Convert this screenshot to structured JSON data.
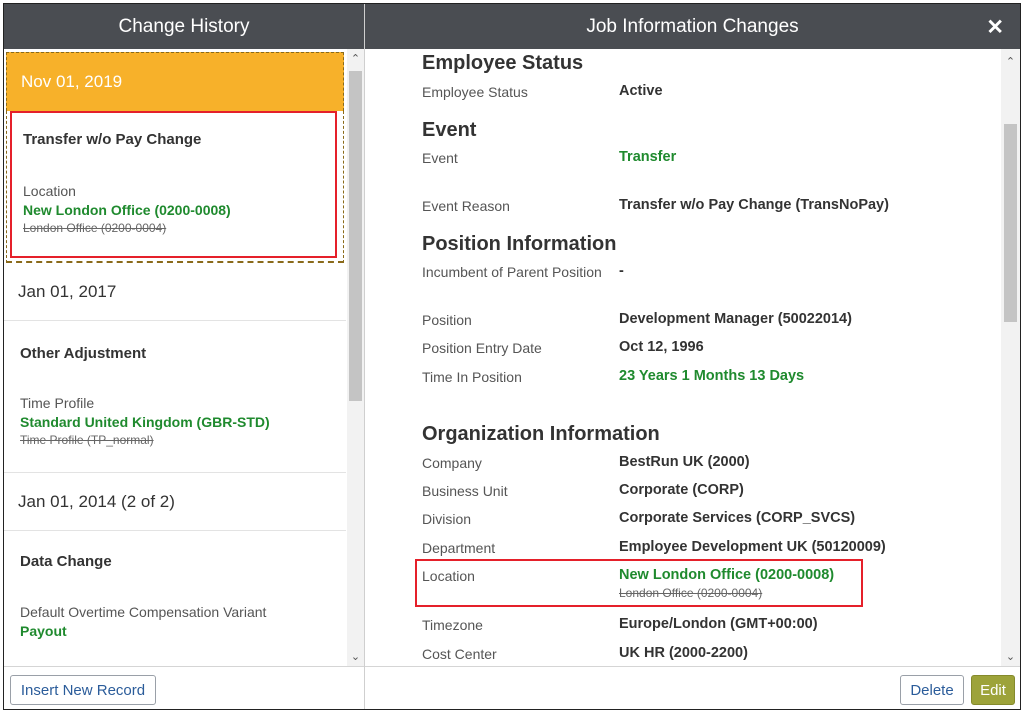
{
  "left_panel": {
    "title": "Change History",
    "records": [
      {
        "date": "Nov 01, 2019",
        "event": "Transfer w/o Pay Change",
        "field_label": "Location",
        "new_value": "New London Office (0200-0008)",
        "old_value": "London Office (0200-0004)"
      },
      {
        "date": "Jan 01, 2017",
        "event": "Other Adjustment",
        "field_label": "Time Profile",
        "new_value": "Standard United Kingdom (GBR-STD)",
        "old_value": "Time Profile (TP_normal)"
      },
      {
        "date": "Jan 01, 2014 (2 of 2)",
        "event": "Data Change",
        "field_label": "Default Overtime Compensation Variant",
        "new_value": "Payout",
        "old_value": ""
      }
    ],
    "insert_button": "Insert New Record"
  },
  "right_panel": {
    "title": "Job Information Changes",
    "close": "✕",
    "sections": {
      "employee_status": {
        "heading": "Employee Status",
        "status_label": "Employee Status",
        "status_value": "Active"
      },
      "event": {
        "heading": "Event",
        "event_label": "Event",
        "event_value": "Transfer",
        "reason_label": "Event Reason",
        "reason_value": "Transfer w/o Pay Change (TransNoPay)"
      },
      "position": {
        "heading": "Position Information",
        "incumbent_label": "Incumbent of Parent Position",
        "incumbent_value": "-",
        "position_label": "Position",
        "position_value": "Development Manager (50022014)",
        "entry_label": "Position Entry Date",
        "entry_value": "Oct 12, 1996",
        "time_label": "Time In Position",
        "time_value": "23 Years 1 Months 13 Days"
      },
      "organization": {
        "heading": "Organization Information",
        "company_label": "Company",
        "company_value": "BestRun UK (2000)",
        "bu_label": "Business Unit",
        "bu_value": "Corporate (CORP)",
        "division_label": "Division",
        "division_value": "Corporate Services (CORP_SVCS)",
        "dept_label": "Department",
        "dept_value": "Employee Development UK (50120009)",
        "location_label": "Location",
        "location_new": "New London Office (0200-0008)",
        "location_old": "London Office (0200-0004)",
        "tz_label": "Timezone",
        "tz_value": "Europe/London (GMT+00:00)",
        "cc_label": "Cost Center",
        "cc_value": "UK HR (2000-2200)"
      }
    },
    "delete_button": "Delete",
    "edit_button": "Edit"
  },
  "colors": {
    "header": "#4a4d52",
    "selected": "#f7b12a",
    "highlight": "#e5202a",
    "changed_value": "#1f8a2e",
    "edit_button": "#9da33a"
  }
}
